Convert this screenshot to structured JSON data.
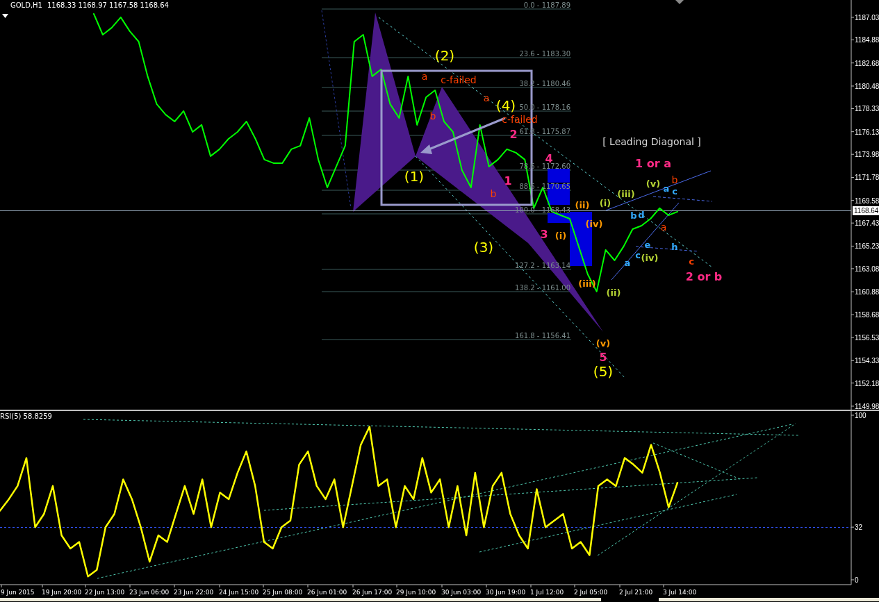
{
  "chart_window": {
    "quote": "1168.33 1168.97 1167.58 1168.64"
  },
  "price_chart": {
    "current_price": "1168.64",
    "chart_data": {
      "type": "line",
      "ylim": [
        1149.58,
        1188.68
      ],
      "yticks": [
        1187.03,
        1184.88,
        1182.68,
        1180.48,
        1178.33,
        1176.13,
        1173.98,
        1171.78,
        1169.58,
        1167.43,
        1165.23,
        1163.08,
        1160.88,
        1158.68,
        1156.53,
        1154.33,
        1152.18,
        1149.98
      ],
      "series": [
        {
          "name": "GOLD,H1",
          "color": "#00ff00",
          "values": [
            1187.36,
            1185.37,
            1186.04,
            1187.03,
            1185.71,
            1184.71,
            1181.41,
            1178.76,
            1177.76,
            1177.1,
            1178.1,
            1176.11,
            1176.78,
            1173.8,
            1174.46,
            1175.45,
            1176.11,
            1177.1,
            1175.45,
            1173.47,
            1173.14,
            1173.14,
            1174.46,
            1174.79,
            1177.44,
            1173.47,
            1170.82,
            1172.81,
            1174.79,
            1184.71,
            1185.37,
            1181.41,
            1182.07,
            1178.76,
            1177.44,
            1181.41,
            1176.78,
            1179.42,
            1180.08,
            1177.1,
            1176.11,
            1172.47,
            1170.82,
            1176.78,
            1172.81,
            1173.47,
            1174.46,
            1174.13,
            1173.47,
            1168.84,
            1170.82,
            1168.51,
            1168.17,
            1167.84,
            1165.2,
            1162.55,
            1160.9,
            1164.87,
            1163.87,
            1165.2,
            1166.85,
            1167.18,
            1167.84,
            1168.84,
            1168.17,
            1168.51
          ]
        }
      ]
    },
    "fibonacci_levels": [
      {
        "label": "0.0 - 1187.89"
      },
      {
        "label": "23.6 - 1183.30"
      },
      {
        "label": "38.2 - 1180.46"
      },
      {
        "label": "50.0 - 1178.16"
      },
      {
        "label": "61.8 - 1175.87"
      },
      {
        "label": "78.6 - 1172.60"
      },
      {
        "label": "88.6 - 1170.65"
      },
      {
        "label": "100.0 - 1168.43"
      },
      {
        "label": "127.2 - 1163.14"
      },
      {
        "label": "138.2 - 1161.00"
      },
      {
        "label": "161.8 - 1156.41"
      }
    ],
    "wave_labels": [
      {
        "text": "(2)",
        "color": "#ffff00"
      },
      {
        "text": "a",
        "color": "#ff4000"
      },
      {
        "text": "c-failed",
        "color": "#ff4000"
      },
      {
        "text": "(4)",
        "color": "#ffff00"
      },
      {
        "text": "b",
        "color": "#ff4000"
      },
      {
        "text": "a",
        "color": "#ff4000"
      },
      {
        "text": "c-failed",
        "color": "#ff4000"
      },
      {
        "text": "2",
        "color": "#ff2a85"
      },
      {
        "text": "[ Leading Diagonal ]",
        "color": "#d8d8d8"
      },
      {
        "text": "4",
        "color": "#ff2a85"
      },
      {
        "text": "1 or a",
        "color": "#ff2a85"
      },
      {
        "text": "(1)",
        "color": "#ffff00"
      },
      {
        "text": "1",
        "color": "#ff2a85"
      },
      {
        "text": "(v)",
        "color": "#b5d334"
      },
      {
        "text": "b",
        "color": "#ff4000"
      },
      {
        "text": "b",
        "color": "#ff4000"
      },
      {
        "text": "(iii)",
        "color": "#b5d334"
      },
      {
        "text": "a",
        "color": "#33aaff"
      },
      {
        "text": "c",
        "color": "#33aaff"
      },
      {
        "text": "(i)",
        "color": "#b5d334"
      },
      {
        "text": "(ii)",
        "color": "#ff9900"
      },
      {
        "text": "b",
        "color": "#33aaff"
      },
      {
        "text": "d",
        "color": "#33aaff"
      },
      {
        "text": "(iv)",
        "color": "#ff9900"
      },
      {
        "text": "a",
        "color": "#ff4000"
      },
      {
        "text": "(3)",
        "color": "#ffff00"
      },
      {
        "text": "3",
        "color": "#ff2a85"
      },
      {
        "text": "(i)",
        "color": "#ff9900"
      },
      {
        "text": "e",
        "color": "#33aaff"
      },
      {
        "text": "h",
        "color": "#33aaff"
      },
      {
        "text": "a",
        "color": "#33aaff"
      },
      {
        "text": "c",
        "color": "#33aaff"
      },
      {
        "text": "(iv)",
        "color": "#b5d334"
      },
      {
        "text": "c",
        "color": "#ff4000"
      },
      {
        "text": "2 or b",
        "color": "#ff2a85"
      },
      {
        "text": "(iii)",
        "color": "#ff9900"
      },
      {
        "text": "(ii)",
        "color": "#b5d334"
      },
      {
        "text": "(v)",
        "color": "#ff9900"
      },
      {
        "text": "5",
        "color": "#ff2a85"
      },
      {
        "text": "(5)",
        "color": "#ffff00"
      }
    ]
  },
  "rsi_panel": {
    "value": "58.8259",
    "chart_data": {
      "type": "line",
      "ylim": [
        -2.95,
        102.95
      ],
      "yticks": [
        100,
        32,
        0
      ],
      "series": [
        {
          "name": "RSI(5)",
          "color": "#ffff00",
          "values": [
            42,
            49,
            57,
            74,
            32,
            40,
            57,
            27,
            19,
            23,
            2,
            6,
            32,
            40,
            61,
            49,
            32,
            11,
            27,
            23,
            40,
            57,
            40,
            61,
            32,
            53,
            49,
            65,
            78,
            57,
            23,
            19,
            32,
            36,
            70,
            78,
            57,
            49,
            61,
            32,
            57,
            82,
            93,
            57,
            61,
            32,
            57,
            49,
            74,
            53,
            61,
            32,
            57,
            27,
            65,
            32,
            57,
            65,
            40,
            27,
            19,
            55,
            32,
            36,
            40,
            19,
            23,
            15,
            57,
            61,
            57,
            74,
            70,
            65,
            82,
            65,
            44,
            59
          ]
        }
      ]
    }
  },
  "time_axis": [
    "9 Jun 2015",
    "19 Jun 20:00",
    "22 Jun 13:00",
    "23 Jun 06:00",
    "23 Jun 22:00",
    "24 Jun 15:00",
    "25 Jun 08:00",
    "26 Jun 01:00",
    "26 Jun 17:00",
    "29 Jun 10:00",
    "30 Jun 03:00",
    "30 Jun 19:00",
    "1 Jul 12:00",
    "2 Jul 05:00",
    "2 Jul 21:00",
    "3 Jul 14:00"
  ]
}
